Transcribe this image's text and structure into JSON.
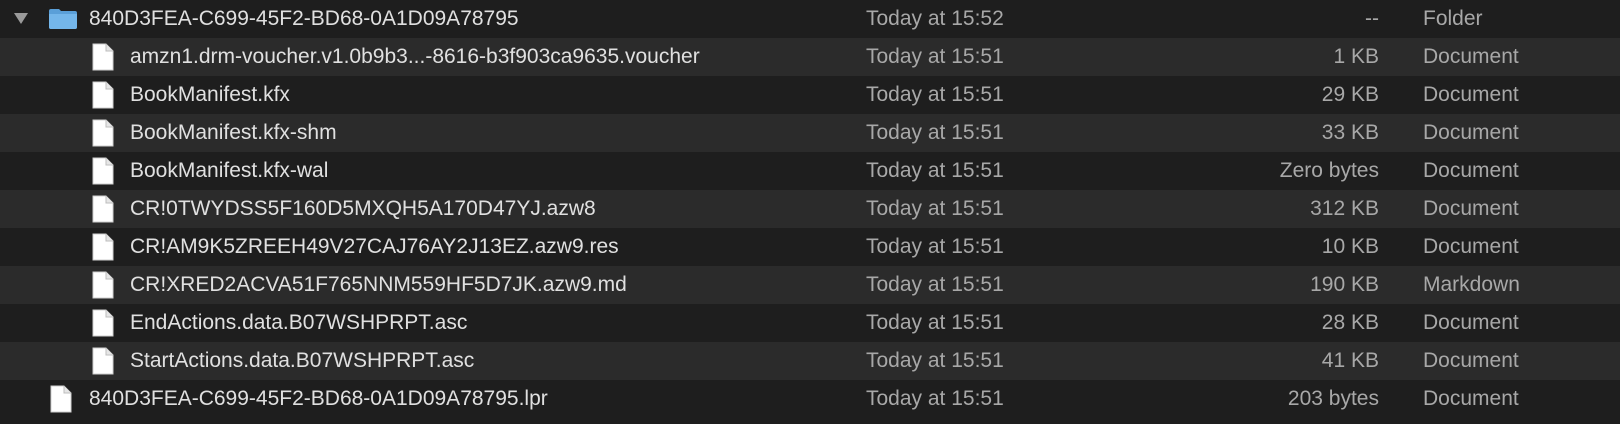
{
  "rows": [
    {
      "name": "840D3FEA-C699-45F2-BD68-0A1D09A78795",
      "date": "Today at 15:52",
      "size": "--",
      "kind": "Folder",
      "icon": "folder-icon",
      "level": 0,
      "expanded": true
    },
    {
      "name": "amzn1.drm-voucher.v1.0b9b3...-8616-b3f903ca9635.voucher",
      "date": "Today at 15:51",
      "size": "1 KB",
      "kind": "Document",
      "icon": "document-icon",
      "level": 1
    },
    {
      "name": "BookManifest.kfx",
      "date": "Today at 15:51",
      "size": "29 KB",
      "kind": "Document",
      "icon": "document-icon",
      "level": 1
    },
    {
      "name": "BookManifest.kfx-shm",
      "date": "Today at 15:51",
      "size": "33 KB",
      "kind": "Document",
      "icon": "document-icon",
      "level": 1
    },
    {
      "name": "BookManifest.kfx-wal",
      "date": "Today at 15:51",
      "size": "Zero bytes",
      "kind": "Document",
      "icon": "document-icon",
      "level": 1
    },
    {
      "name": "CR!0TWYDSS5F160D5MXQH5A170D47YJ.azw8",
      "date": "Today at 15:51",
      "size": "312 KB",
      "kind": "Document",
      "icon": "document-icon",
      "level": 1
    },
    {
      "name": "CR!AM9K5ZREEH49V27CAJ76AY2J13EZ.azw9.res",
      "date": "Today at 15:51",
      "size": "10 KB",
      "kind": "Document",
      "icon": "document-icon",
      "level": 1
    },
    {
      "name": "CR!XRED2ACVA51F765NNM559HF5D7JK.azw9.md",
      "date": "Today at 15:51",
      "size": "190 KB",
      "kind": "Markdown",
      "icon": "document-icon",
      "level": 1
    },
    {
      "name": "EndActions.data.B07WSHPRPT.asc",
      "date": "Today at 15:51",
      "size": "28 KB",
      "kind": "Document",
      "icon": "document-icon",
      "level": 1
    },
    {
      "name": "StartActions.data.B07WSHPRPT.asc",
      "date": "Today at 15:51",
      "size": "41 KB",
      "kind": "Document",
      "icon": "document-icon",
      "level": 1
    },
    {
      "name": "840D3FEA-C699-45F2-BD68-0A1D09A78795.lpr",
      "date": "Today at 15:51",
      "size": "203 bytes",
      "kind": "Document",
      "icon": "document-icon",
      "level": 0
    }
  ],
  "colors": {
    "row_even": "#1e1e1e",
    "row_odd": "#2b2b2b",
    "folder": "#6fb0e6",
    "document": "#ffffff",
    "text_primary": "#e0e0e0",
    "text_secondary": "#a8a8a8"
  }
}
